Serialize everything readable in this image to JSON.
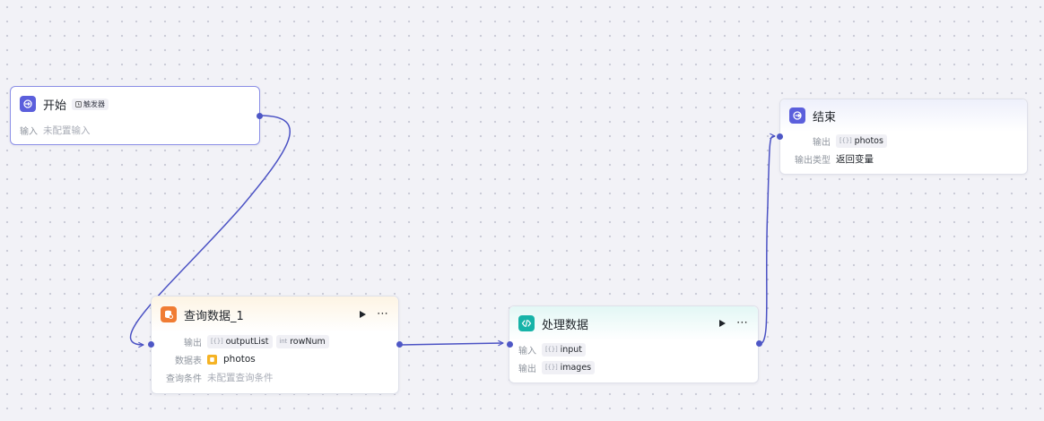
{
  "colors": {
    "edge": "#4b52c4",
    "handle": "#4e57c6",
    "start_icon_bg": "#5b5fdc",
    "query_icon_bg": "#f07c33",
    "code_icon_bg": "#17b3a8",
    "end_icon_bg": "#5b5fdc",
    "db_icon_bg": "#f5b324"
  },
  "nodes": {
    "start": {
      "icon": "login-arrow-icon",
      "title": "开始",
      "trigger_badge": "触发器",
      "input_label": "输入",
      "input_value": "未配置输入"
    },
    "query": {
      "icon": "database-query-icon",
      "title": "查询数据_1",
      "output_label": "输出",
      "outputs": [
        {
          "type": "[{}]",
          "name": "outputList"
        },
        {
          "type": "int",
          "name": "rowNum"
        }
      ],
      "table_label": "数据表",
      "table_value": "photos",
      "condition_label": "查询条件",
      "condition_value": "未配置查询条件"
    },
    "process": {
      "icon": "code-brackets-icon",
      "title": "处理数据",
      "input_label": "输入",
      "input": {
        "type": "[{}]",
        "name": "input"
      },
      "output_label": "输出",
      "output": {
        "type": "[{}]",
        "name": "images"
      }
    },
    "end": {
      "icon": "logout-arrow-icon",
      "title": "结束",
      "output_label": "输出",
      "output": {
        "type": "[{}]",
        "name": "photos"
      },
      "output_type_label": "输出类型",
      "output_type_value": "返回变量"
    }
  }
}
